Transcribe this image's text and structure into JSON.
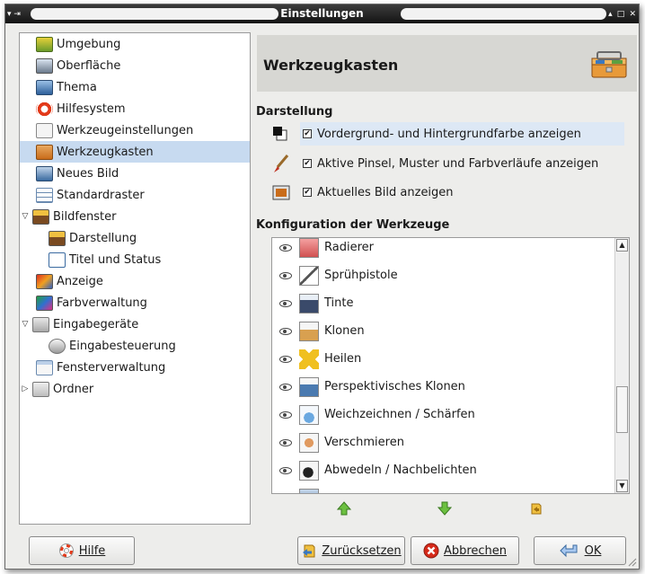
{
  "window": {
    "title": "Einstellungen",
    "left_glyphs": "▾ ⇥",
    "right_glyphs": "▴ □ ✕"
  },
  "tree": [
    {
      "label": "Umgebung",
      "icon": "environment-icon",
      "indent": 1
    },
    {
      "label": "Oberfläche",
      "icon": "interface-icon",
      "indent": 1
    },
    {
      "label": "Thema",
      "icon": "theme-icon",
      "indent": 1
    },
    {
      "label": "Hilfesystem",
      "icon": "lifebuoy-icon",
      "indent": 1
    },
    {
      "label": "Werkzeugeinstellungen",
      "icon": "tool-options-icon",
      "indent": 1
    },
    {
      "label": "Werkzeugkasten",
      "icon": "toolbox-icon",
      "indent": 1,
      "selected": true
    },
    {
      "label": "Neues Bild",
      "icon": "new-image-icon",
      "indent": 1
    },
    {
      "label": "Standardraster",
      "icon": "grid-icon",
      "indent": 1
    },
    {
      "label": "Bildfenster",
      "icon": "image-window-icon",
      "indent": 0,
      "expander": "▽"
    },
    {
      "label": "Darstellung",
      "icon": "appearance-icon",
      "indent": 2
    },
    {
      "label": "Titel und Status",
      "icon": "title-status-icon",
      "indent": 2
    },
    {
      "label": "Anzeige",
      "icon": "display-icon",
      "indent": 1
    },
    {
      "label": "Farbverwaltung",
      "icon": "color-management-icon",
      "indent": 1
    },
    {
      "label": "Eingabegeräte",
      "icon": "input-devices-icon",
      "indent": 0,
      "expander": "▽"
    },
    {
      "label": "Eingabesteuerung",
      "icon": "input-controllers-icon",
      "indent": 2
    },
    {
      "label": "Fensterverwaltung",
      "icon": "window-management-icon",
      "indent": 1
    },
    {
      "label": "Ordner",
      "icon": "folders-icon",
      "indent": 0,
      "expander": "▷"
    }
  ],
  "header": {
    "title": "Werkzeugkasten"
  },
  "darstellung": {
    "title": "Darstellung",
    "options": [
      {
        "label": "Vordergrund- und Hintergrundfarbe anzeigen",
        "checked": true,
        "icon": "fg-bg-color-icon",
        "highlight": true
      },
      {
        "label": "Aktive Pinsel, Muster und Farbverläufe anzeigen",
        "checked": true,
        "icon": "brush-icon"
      },
      {
        "label": "Aktuelles Bild anzeigen",
        "checked": true,
        "icon": "active-image-icon"
      }
    ]
  },
  "konfiguration": {
    "title": "Konfiguration der Werkzeuge",
    "tools": [
      {
        "label": "Radierer",
        "icon": "eraser-icon",
        "visible": true
      },
      {
        "label": "Sprühpistole",
        "icon": "airbrush-icon",
        "visible": true
      },
      {
        "label": "Tinte",
        "icon": "ink-icon",
        "visible": true
      },
      {
        "label": "Klonen",
        "icon": "clone-icon",
        "visible": true
      },
      {
        "label": "Heilen",
        "icon": "heal-icon",
        "visible": true
      },
      {
        "label": "Perspektivisches Klonen",
        "icon": "perspective-clone-icon",
        "visible": true
      },
      {
        "label": "Weichzeichnen / Schärfen",
        "icon": "blur-sharpen-icon",
        "visible": true
      },
      {
        "label": "Verschmieren",
        "icon": "smudge-icon",
        "visible": true
      },
      {
        "label": "Abwedeln / Nachbelichten",
        "icon": "dodge-burn-icon",
        "visible": true
      }
    ]
  },
  "buttons": {
    "help": "Hilfe",
    "reset": "Zurücksetzen",
    "cancel": "Abbrechen",
    "ok": "OK"
  },
  "colors": {
    "selection": "#c7daf0",
    "header_bg": "#d7d7d3",
    "window_bg": "#ededeb"
  }
}
